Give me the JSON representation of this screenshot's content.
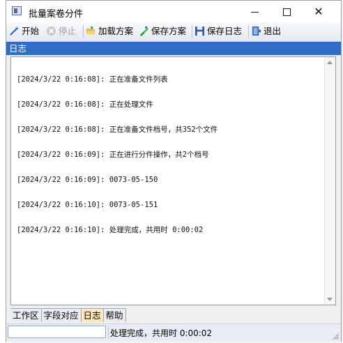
{
  "window": {
    "title": "批量案卷分件"
  },
  "toolbar": {
    "start_label": "开始",
    "stop_label": "停止",
    "load_label": "加载方案",
    "save_label": "保存方案",
    "save_log_label": "保存日志",
    "exit_label": "退出"
  },
  "pane": {
    "title": "日志"
  },
  "log": {
    "lines": [
      "[2024/3/22 0:16:08]: 正在准备文件列表",
      "[2024/3/22 0:16:08]: 正在处理文件",
      "[2024/3/22 0:16:08]: 正在准备文件档号，共352个文件",
      "[2024/3/22 0:16:09]: 正在进行分件操作，共2个档号",
      "[2024/3/22 0:16:09]: 0073-05-150",
      "[2024/3/22 0:16:10]: 0073-05-151",
      "[2024/3/22 0:16:10]: 处理完成，共用时 0:00:02"
    ]
  },
  "tabs": [
    {
      "label": "工作区",
      "active": false
    },
    {
      "label": "字段对应",
      "active": false
    },
    {
      "label": "日志",
      "active": true
    },
    {
      "label": "帮助",
      "active": false
    }
  ],
  "status": {
    "input_value": "",
    "text": "处理完成，共用时 0:00:02"
  },
  "colors": {
    "pane_header": "#2f6ec6",
    "active_tab": "#ffe8b8"
  }
}
